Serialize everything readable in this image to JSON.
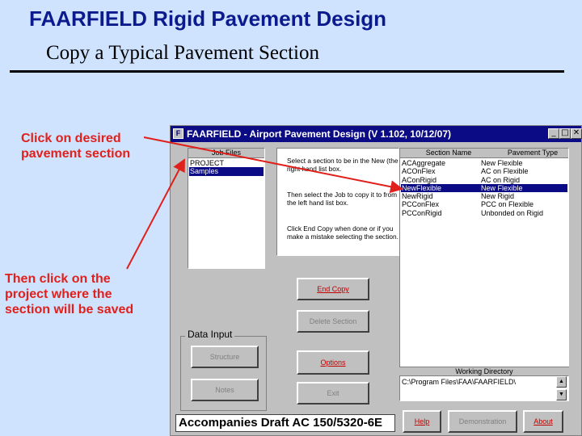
{
  "slide": {
    "title": "FAARFIELD Rigid Pavement Design",
    "subtitle": "Copy a Typical Pavement Section",
    "callout_1": "Click on desired pavement section",
    "callout_2": "Then click on the project where the section will be saved"
  },
  "window": {
    "title": "FAARFIELD - Airport Pavement Design (V 1.102, 10/12/07)",
    "minimize": "_",
    "maximize": "□",
    "close": "✕"
  },
  "job_files": {
    "header": "Job Files",
    "items": [
      "PROJECT",
      "Samples"
    ],
    "selected": "Samples"
  },
  "instructions": [
    "Select a section to be in the New (the right hand list box.",
    "Then select the Job to copy it to from the left hand list box.",
    "Click End Copy when done or if you make a mistake selecting the section."
  ],
  "sections": {
    "col_name": "Section Name",
    "col_type": "Pavement Type",
    "rows": [
      {
        "name": "ACAggregate",
        "type": "New Flexible"
      },
      {
        "name": "ACOnFlex",
        "type": "AC on Flexible"
      },
      {
        "name": "AConRigid",
        "type": "AC on Rigid"
      },
      {
        "name": "NewFlexible",
        "type": "New Flexible"
      },
      {
        "name": "NewRigid",
        "type": "New Rigid"
      },
      {
        "name": "PCConFlex",
        "type": "PCC on Flexible"
      },
      {
        "name": "PCConRigid",
        "type": "Unbonded on Rigid"
      }
    ],
    "selected": "NewFlexible"
  },
  "buttons": {
    "end_copy": "End Copy",
    "delete_section": "Delete Section",
    "options": "Options",
    "exit": "Exit",
    "structure": "Structure",
    "notes": "Notes",
    "help": "Help",
    "demonstration": "Demonstration",
    "about": "About"
  },
  "data_input": {
    "label": "Data Input"
  },
  "working_directory": {
    "label": "Working Directory",
    "path": "C:\\Program Files\\FAA\\FAARFIELD\\"
  },
  "status_bar": {
    "text": "Accompanies Draft AC 150/5320-6E"
  },
  "colors": {
    "title": "#0b1a8c",
    "callout": "#e0201b",
    "titlebar": "#0b0b86",
    "background": "#cfe3ff",
    "window": "#c0c0c0"
  }
}
